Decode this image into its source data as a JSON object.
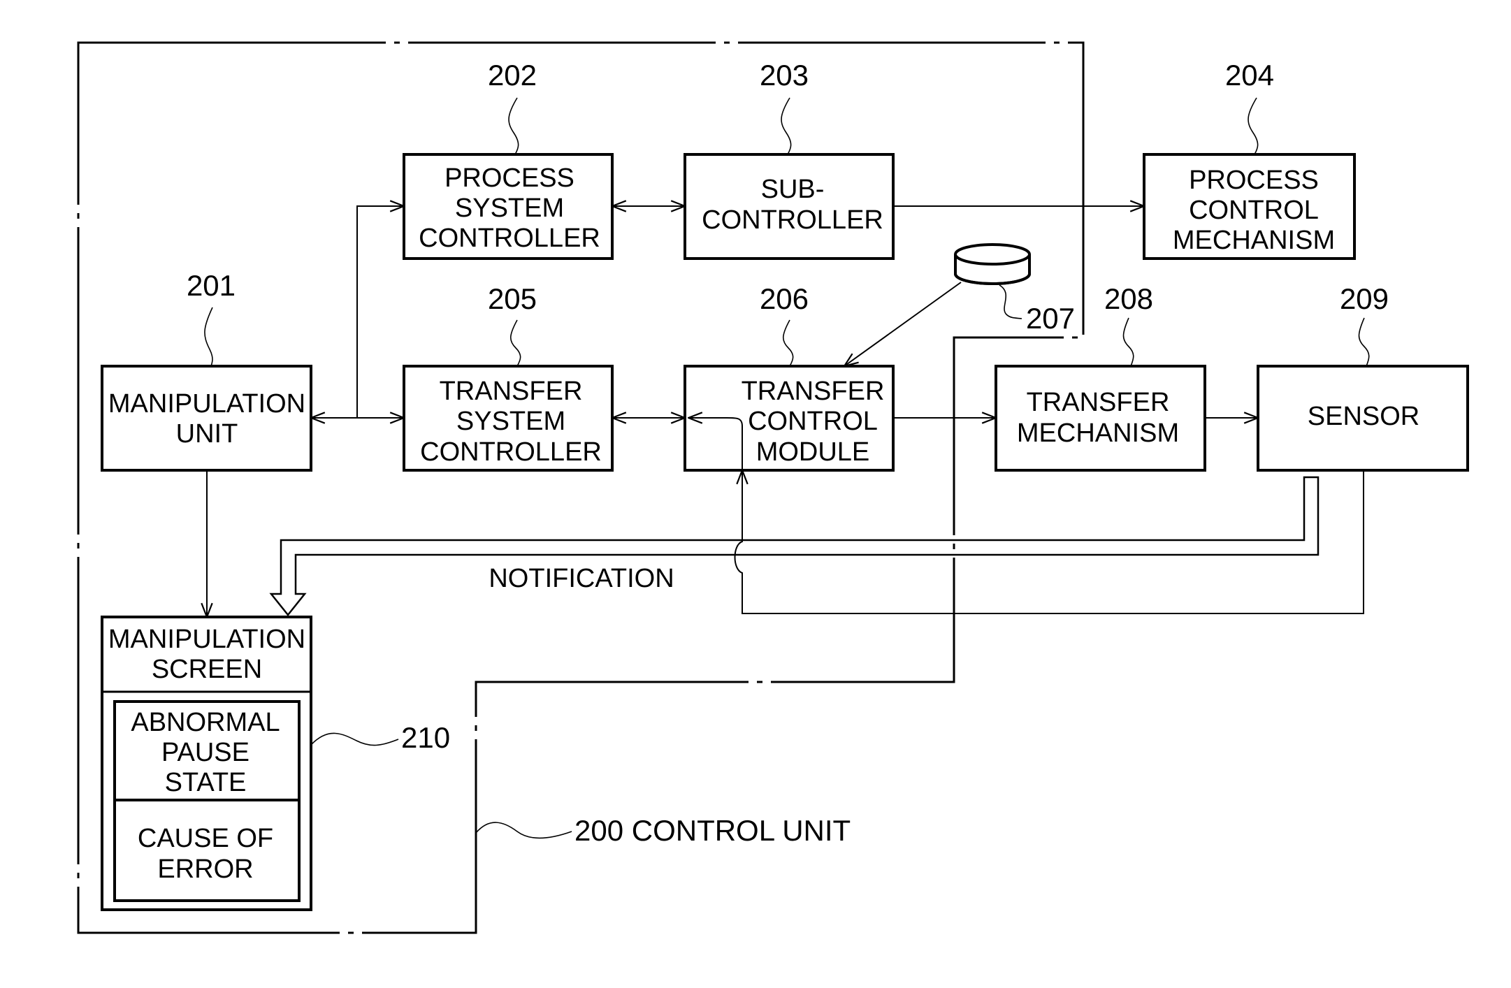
{
  "diagram": {
    "control_unit": {
      "ref": "200",
      "label": "200 CONTROL UNIT"
    },
    "blocks": [
      {
        "id": "manipulation-unit",
        "ref": "201",
        "lines": [
          "MANIPULATION",
          "UNIT"
        ]
      },
      {
        "id": "process-system-controller",
        "ref": "202",
        "lines": [
          "PROCESS",
          "SYSTEM",
          "CONTROLLER"
        ]
      },
      {
        "id": "sub-controller",
        "ref": "203",
        "lines": [
          "SUB-",
          "CONTROLLER"
        ]
      },
      {
        "id": "process-control-mechanism",
        "ref": "204",
        "lines": [
          "PROCESS",
          "CONTROL",
          "MECHANISM"
        ]
      },
      {
        "id": "transfer-system-controller",
        "ref": "205",
        "lines": [
          "TRANSFER",
          "SYSTEM",
          "CONTROLLER"
        ]
      },
      {
        "id": "transfer-control-module",
        "ref": "206",
        "lines": [
          "TRANSFER",
          "CONTROL",
          "MODULE"
        ]
      },
      {
        "id": "storage",
        "ref": "207",
        "lines": []
      },
      {
        "id": "transfer-mechanism",
        "ref": "208",
        "lines": [
          "TRANSFER",
          "MECHANISM"
        ]
      },
      {
        "id": "sensor",
        "ref": "209",
        "lines": [
          "SENSOR"
        ]
      }
    ],
    "manipulation_screen": {
      "lines": [
        "MANIPULATION",
        "SCREEN"
      ],
      "ref": "210",
      "state_lines": [
        "ABNORMAL",
        "PAUSE",
        "STATE"
      ],
      "cause_lines": [
        "CAUSE OF",
        "ERROR"
      ]
    },
    "notification_label": "NOTIFICATION"
  }
}
